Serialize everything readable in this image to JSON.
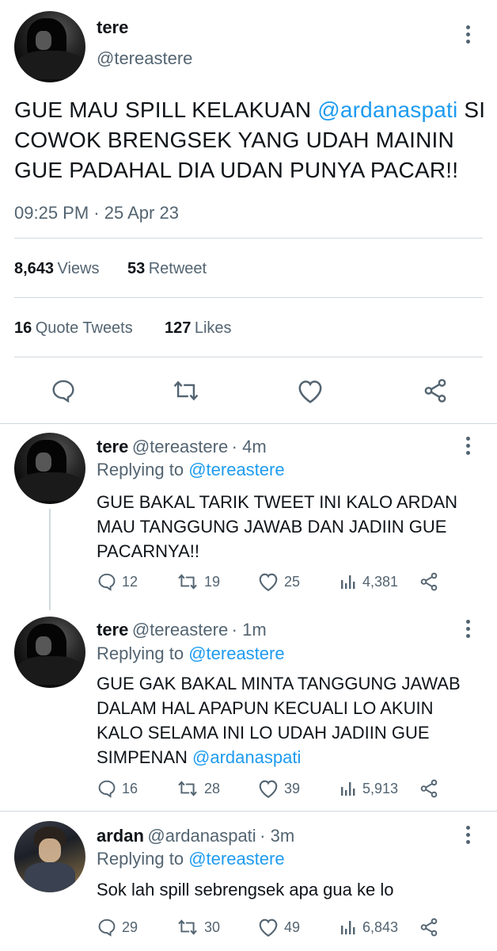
{
  "main_tweet": {
    "name": "tere",
    "handle": "@tereastere",
    "text_before": "GUE MAU SPILL KELAKUAN ",
    "mention": "@ardanaspati",
    "text_after": "SI COWOK BRENGSEK YANG UDAH MAININ GUE PADAHAL DIA UDAN PUNYA PACAR!!",
    "time": "09:25 PM",
    "date_sep": "·",
    "date": "25 Apr 23",
    "views_count": "8,643",
    "views_label": "Views",
    "retweet_count": "53",
    "retweet_label": "Retweet",
    "quote_count": "16",
    "quote_label": "Quote Tweets",
    "likes_count": "127",
    "likes_label": "Likes"
  },
  "replies": [
    {
      "name": "tere",
      "handle": "@tereastere",
      "time": "· 4m",
      "replying_prefix": "Replying to",
      "replying_to": "@tereastere",
      "text": "GUE BAKAL TARIK TWEET INI KALO ARDAN MAU TANGGUNG JAWAB DAN JADIIN GUE PACARNYA!!",
      "mention": "",
      "comments": "12",
      "retweets": "19",
      "likes": "25",
      "views": "4,381"
    },
    {
      "name": "tere",
      "handle": "@tereastere",
      "time": "· 1m",
      "replying_prefix": "Replying to",
      "replying_to": "@tereastere",
      "text": "GUE GAK BAKAL MINTA TANGGUNG JAWAB DALAM HAL APAPUN KECUALI LO AKUIN KALO SELAMA INI LO UDAH JADIIN GUE SIMPENAN ",
      "mention": "@ardanaspati",
      "comments": "16",
      "retweets": "28",
      "likes": "39",
      "views": "5,913"
    },
    {
      "name": "ardan",
      "handle": "@ardanaspati",
      "time": "· 3m",
      "replying_prefix": "Replying to",
      "replying_to": "@tereastere",
      "text": "Sok lah spill sebrengsek apa gua ke lo",
      "mention": "",
      "comments": "29",
      "retweets": "30",
      "likes": "49",
      "views": "6,843"
    }
  ],
  "colors": {
    "accent": "#1d9bf0",
    "secondary_text": "#536471",
    "divider": "#cfd9de"
  },
  "icons": [
    "more-icon",
    "comment-icon",
    "retweet-icon",
    "like-icon",
    "share-icon",
    "views-icon"
  ]
}
